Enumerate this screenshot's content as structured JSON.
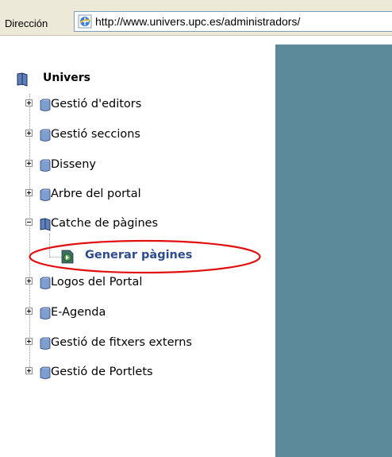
{
  "address_bar": {
    "label": "Dirección",
    "url": "http://www.univers.upc.es/administradors/"
  },
  "tree": {
    "root": {
      "label": "Univers",
      "icon": "folder-icon"
    },
    "items": [
      {
        "label": "Gestió d'editors",
        "expanded": false
      },
      {
        "label": "Gestió seccions",
        "expanded": false
      },
      {
        "label": "Disseny",
        "expanded": false
      },
      {
        "label": "Arbre del portal",
        "expanded": false
      },
      {
        "label": "Catche de pàgines",
        "expanded": true,
        "children": [
          {
            "label": "Generar pàgines",
            "icon": "page-action-icon",
            "highlighted": true
          }
        ]
      },
      {
        "label": "Logos del Portal",
        "expanded": false
      },
      {
        "label": "E-Agenda",
        "expanded": false
      },
      {
        "label": "Gestió de fitxers externs",
        "expanded": false
      },
      {
        "label": "Gestió de Portlets",
        "expanded": false
      }
    ]
  },
  "colors": {
    "right_frame": "#5c8a9b",
    "highlight_ellipse": "#e01010",
    "leaf_link": "#2d4b8e",
    "folder": "#6e8fc4"
  }
}
